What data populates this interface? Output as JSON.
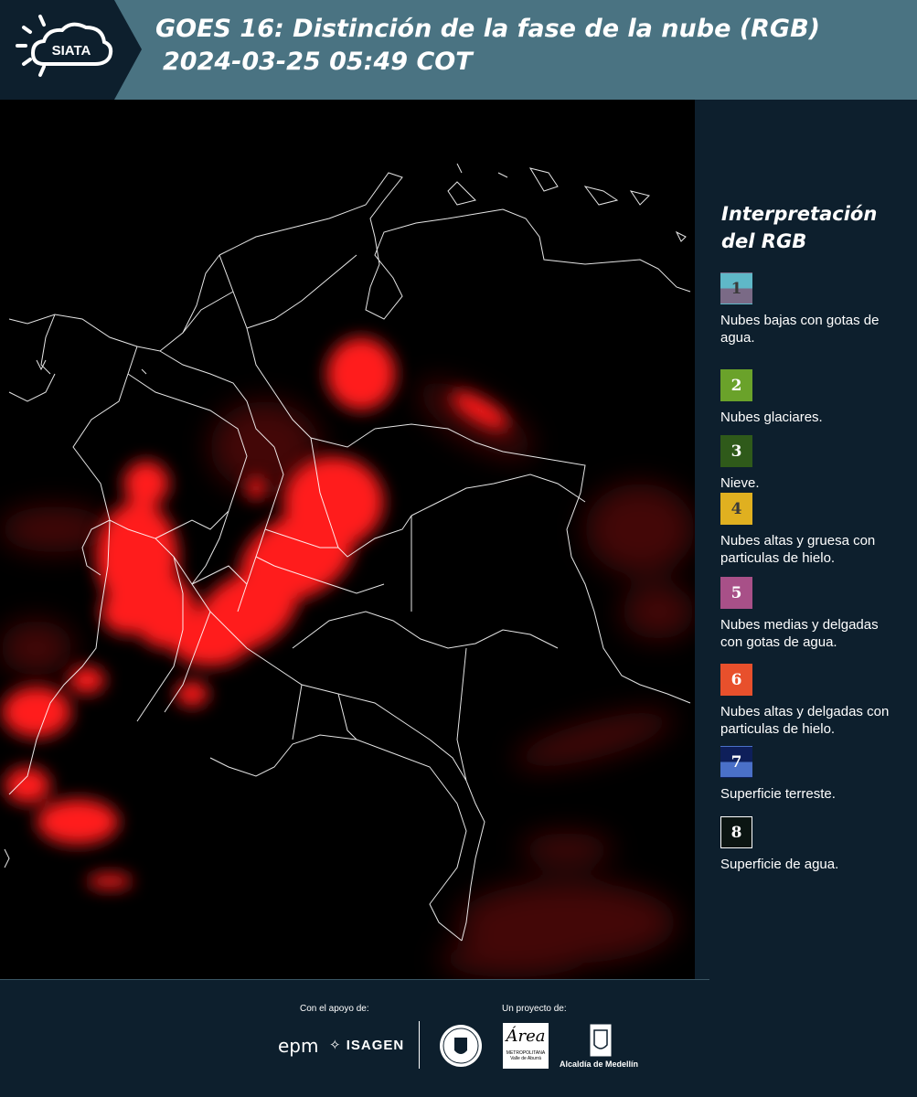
{
  "header": {
    "logo_text": "SIATA",
    "title_line1": "GOES 16: Distinción de la fase de la nube (RGB)",
    "title_line2": "2024-03-25 05:49 COT"
  },
  "legend": {
    "title_line1": "Interpretación",
    "title_line2": "del RGB",
    "items": [
      {
        "number": "1",
        "label": "Nubes bajas con gotas de agua.",
        "color_top": "#5fb8c8",
        "color_bottom": "#7a6a86",
        "num_color": "#3a3a3a"
      },
      {
        "number": "2",
        "label": "Nubes glaciares.",
        "color_top": "#6aa22a",
        "color_bottom": "#6aa22a",
        "num_color": "#ffffff"
      },
      {
        "number": "3",
        "label": "Nieve.",
        "color_top": "#2f5a1a",
        "color_bottom": "#2f5a1a",
        "num_color": "#ffffff"
      },
      {
        "number": "4",
        "label": "Nubes altas y gruesa con particulas de hielo.",
        "color_top": "#e0b020",
        "color_bottom": "#e0b020",
        "num_color": "#3a3a3a"
      },
      {
        "number": "5",
        "label": "Nubes medias y delgadas con gotas de agua.",
        "color_top": "#a85088",
        "color_bottom": "#a85088",
        "num_color": "#ffffff"
      },
      {
        "number": "6",
        "label": "Nubes altas y delgadas con particulas de hielo.",
        "color_top": "#e8502c",
        "color_bottom": "#e8502c",
        "num_color": "#ffffff"
      },
      {
        "number": "7",
        "label": "Superficie terreste.",
        "color_top": "#0e1f5a",
        "color_bottom": "#4a70c8",
        "num_color": "#ffffff"
      },
      {
        "number": "8",
        "label": "Superficie de agua.",
        "color_top": "#0b1512",
        "color_bottom": "#0b1512",
        "num_color": "#ffffff"
      }
    ]
  },
  "footer": {
    "support_label": "Con el apoyo de:",
    "project_label": "Un proyecto de:",
    "epm": "epm",
    "isagen": "ISAGEN",
    "area_logo": "Área",
    "area_sub": "METROPOLITANA Valle de Aburrá",
    "alcaldia": "Alcaldía de Medellín"
  },
  "colors": {
    "header_bg": "#4a7382",
    "panel_bg": "#0d1f2d",
    "cloud_red": "#ff1a1a",
    "border_white": "#ffffff"
  }
}
